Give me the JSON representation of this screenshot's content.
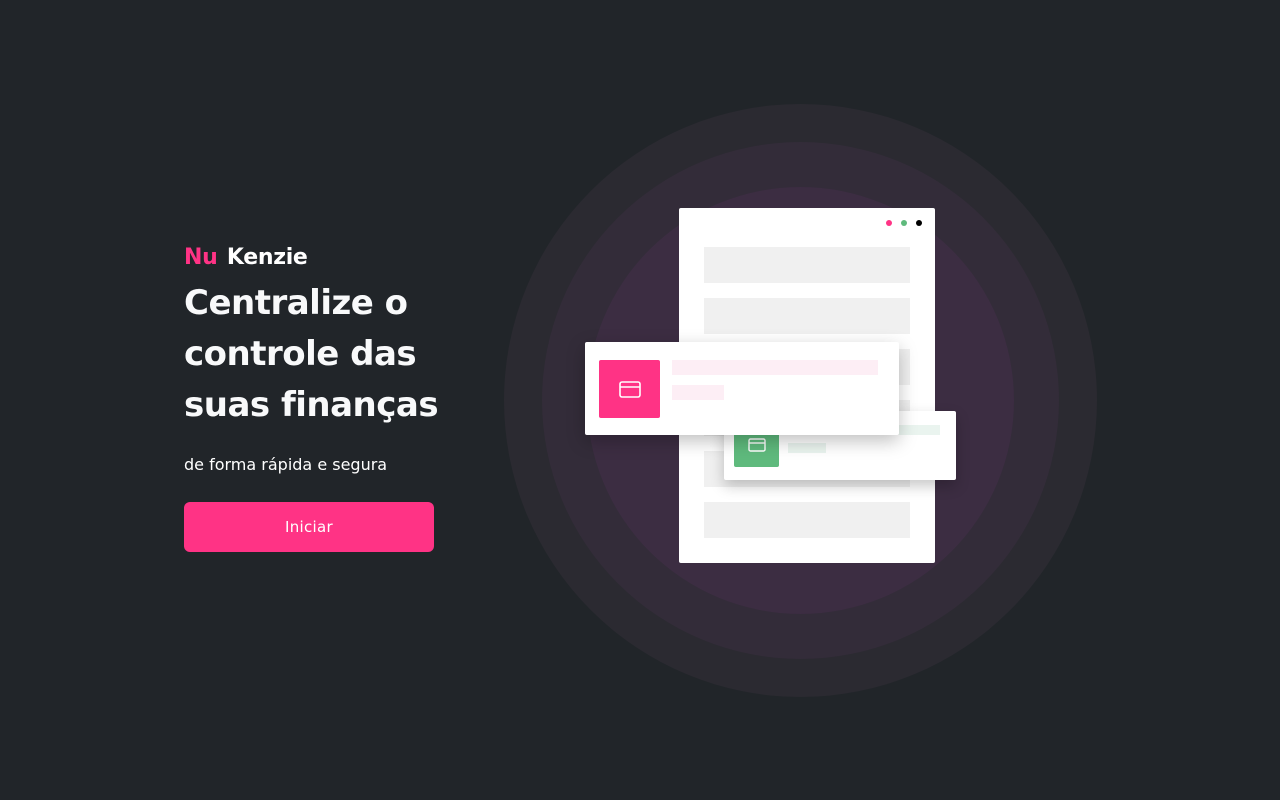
{
  "brand": {
    "prefix": "Nu",
    "name": "Kenzie"
  },
  "hero": {
    "headline": "Centralize o controle das suas finanças",
    "subtitle": "de forma rápida e segura",
    "cta_label": "Iniciar"
  },
  "illustration": {
    "window_dots": [
      "pink",
      "green",
      "black"
    ],
    "card_icon": "credit-card-icon"
  },
  "colors": {
    "background": "#212529",
    "accent": "#ff3385",
    "success": "#5fba7d",
    "text": "#ffffff"
  }
}
